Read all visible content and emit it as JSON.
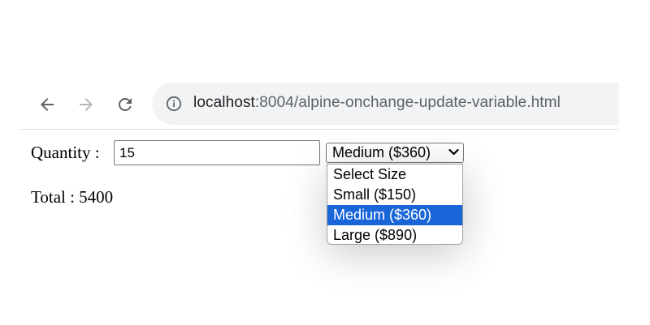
{
  "browser": {
    "url_host": "localhost",
    "url_rest": ":8004/alpine-onchange-update-variable.html"
  },
  "form": {
    "quantity_label": "Quantity :",
    "quantity_value": "15",
    "size_selected": "Medium ($360)",
    "size_options": [
      "Select Size",
      "Small ($150)",
      "Medium ($360)",
      "Large ($890)"
    ],
    "highlighted_index": 2
  },
  "total": {
    "label": "Total : 5400"
  },
  "colors": {
    "highlight": "#1a66d9",
    "omnibox_bg": "#f1f3f4"
  }
}
